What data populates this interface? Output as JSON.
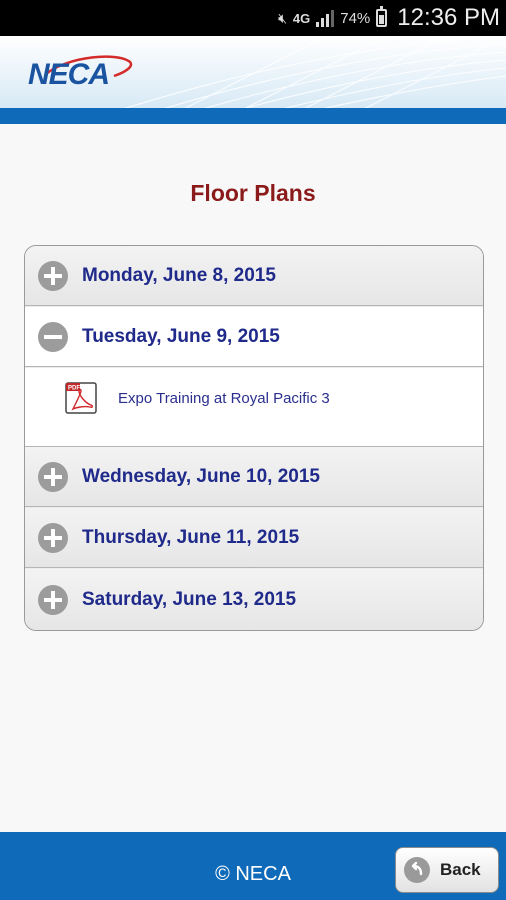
{
  "status_bar": {
    "network": "4G",
    "battery_percent": "74%",
    "battery_level": 0.74,
    "time": "12:36 PM",
    "icons": [
      "mute-icon",
      "signal-icon",
      "battery-icon"
    ]
  },
  "header": {
    "logo_text": "NECA",
    "colors": {
      "brand_blue": "#1a53a0",
      "swoosh_red": "#d42b2b",
      "bar_blue": "#0f6ab9"
    }
  },
  "page": {
    "title": "Floor Plans"
  },
  "accordion": {
    "sections": [
      {
        "label": "Monday, June 8, 2015",
        "expanded": false,
        "icon": "plus-icon"
      },
      {
        "label": "Tuesday, June 9, 2015",
        "expanded": true,
        "icon": "minus-icon",
        "items": [
          {
            "label": "Expo Training at Royal Pacific 3",
            "icon": "pdf-icon"
          }
        ]
      },
      {
        "label": "Wednesday, June 10, 2015",
        "expanded": false,
        "icon": "plus-icon"
      },
      {
        "label": "Thursday, June 11, 2015",
        "expanded": false,
        "icon": "plus-icon"
      },
      {
        "label": "Saturday, June 13, 2015",
        "expanded": false,
        "icon": "plus-icon"
      }
    ]
  },
  "footer": {
    "text": "© NECA",
    "back_label": "Back"
  }
}
